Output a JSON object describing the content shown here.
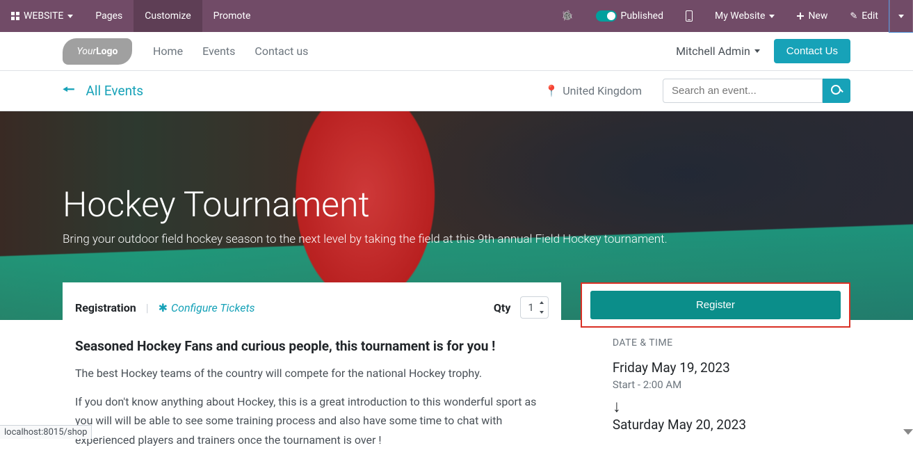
{
  "topbar": {
    "website": "WEBSITE",
    "pages": "Pages",
    "customize": "Customize",
    "promote": "Promote",
    "published": "Published",
    "my_website": "My Website",
    "new": "New",
    "edit": "Edit"
  },
  "nav": {
    "logo_pre": "Your",
    "logo_em": "Logo",
    "items": [
      "Home",
      "Events",
      "Contact us"
    ],
    "user": "Mitchell Admin",
    "contact": "Contact Us"
  },
  "subbar": {
    "back": "All Events",
    "location": "United Kingdom",
    "search_ph": "Search an event..."
  },
  "hero": {
    "title": "Hockey Tournament",
    "sub": "Bring your outdoor field hockey season to the next level by taking the field at this 9th annual Field Hockey tournament."
  },
  "reg": {
    "label": "Registration",
    "configure": "Configure Tickets",
    "qty": "Qty",
    "qty_val": "1",
    "register": "Register"
  },
  "body": {
    "h": "Seasoned Hockey Fans and curious people, this tournament is for you !",
    "p1": "The best Hockey teams of the country will compete for the national Hockey trophy.",
    "p2": "If you don't know anything about Hockey, this is a great introduction to this wonderful sport as you will will be able to see some training process and also have some time to chat with experienced players and trainers once the tournament is over !"
  },
  "side": {
    "dt_label": "DATE & TIME",
    "date1": "Friday May 19, 2023",
    "time1": "Start - 2:00 AM",
    "date2": "Saturday May 20, 2023"
  },
  "status": "localhost:8015/shop"
}
